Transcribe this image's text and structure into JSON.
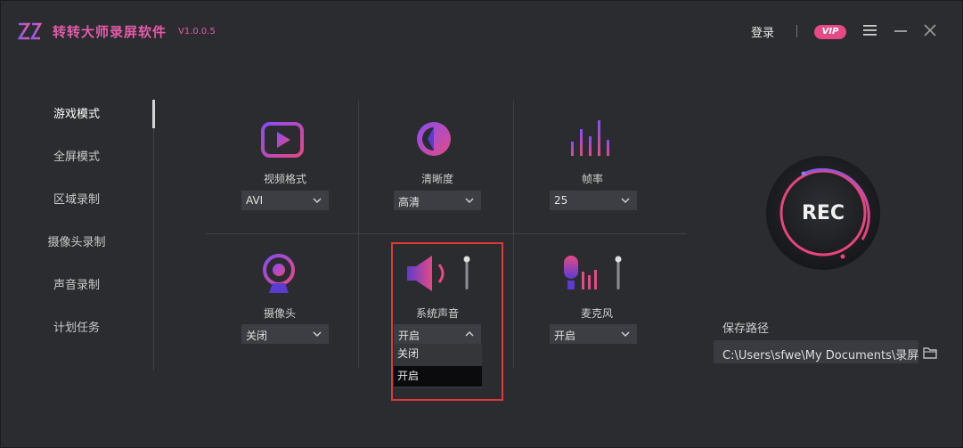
{
  "app": {
    "title": "转转大师录屏软件",
    "version": "V1.0.0.5"
  },
  "header": {
    "login": "登录",
    "vip": "VIP"
  },
  "sidebar": {
    "items": [
      {
        "label": "游戏模式",
        "active": true
      },
      {
        "label": "全屏模式"
      },
      {
        "label": "区域录制"
      },
      {
        "label": "摄像头录制"
      },
      {
        "label": "声音录制"
      },
      {
        "label": "计划任务"
      }
    ]
  },
  "options": {
    "video_format": {
      "label": "视频格式",
      "value": "AVI"
    },
    "clarity": {
      "label": "清晰度",
      "value": "高清"
    },
    "frame_rate": {
      "label": "帧率",
      "value": "25"
    },
    "camera": {
      "label": "摄像头",
      "value": "关闭"
    },
    "system_sound": {
      "label": "系统声音",
      "value": "开启",
      "dropdown": [
        "关闭",
        "开启"
      ]
    },
    "microphone": {
      "label": "麦克风",
      "value": "开启"
    }
  },
  "record": {
    "label": "REC"
  },
  "save": {
    "label": "保存路径",
    "path": "C:\\Users\\sfwe\\My Documents\\录屏"
  },
  "colors": {
    "accent": "#e45aa9",
    "background": "#2b2c30",
    "highlight": "#e23838",
    "rec_ring": "#e8457a"
  },
  "icons": [
    "logo-icon",
    "menu-icon",
    "minimize-icon",
    "close-icon",
    "video-format-icon",
    "clarity-icon",
    "frame-rate-icon",
    "camera-icon",
    "speaker-icon",
    "mic-icon",
    "folder-icon"
  ]
}
